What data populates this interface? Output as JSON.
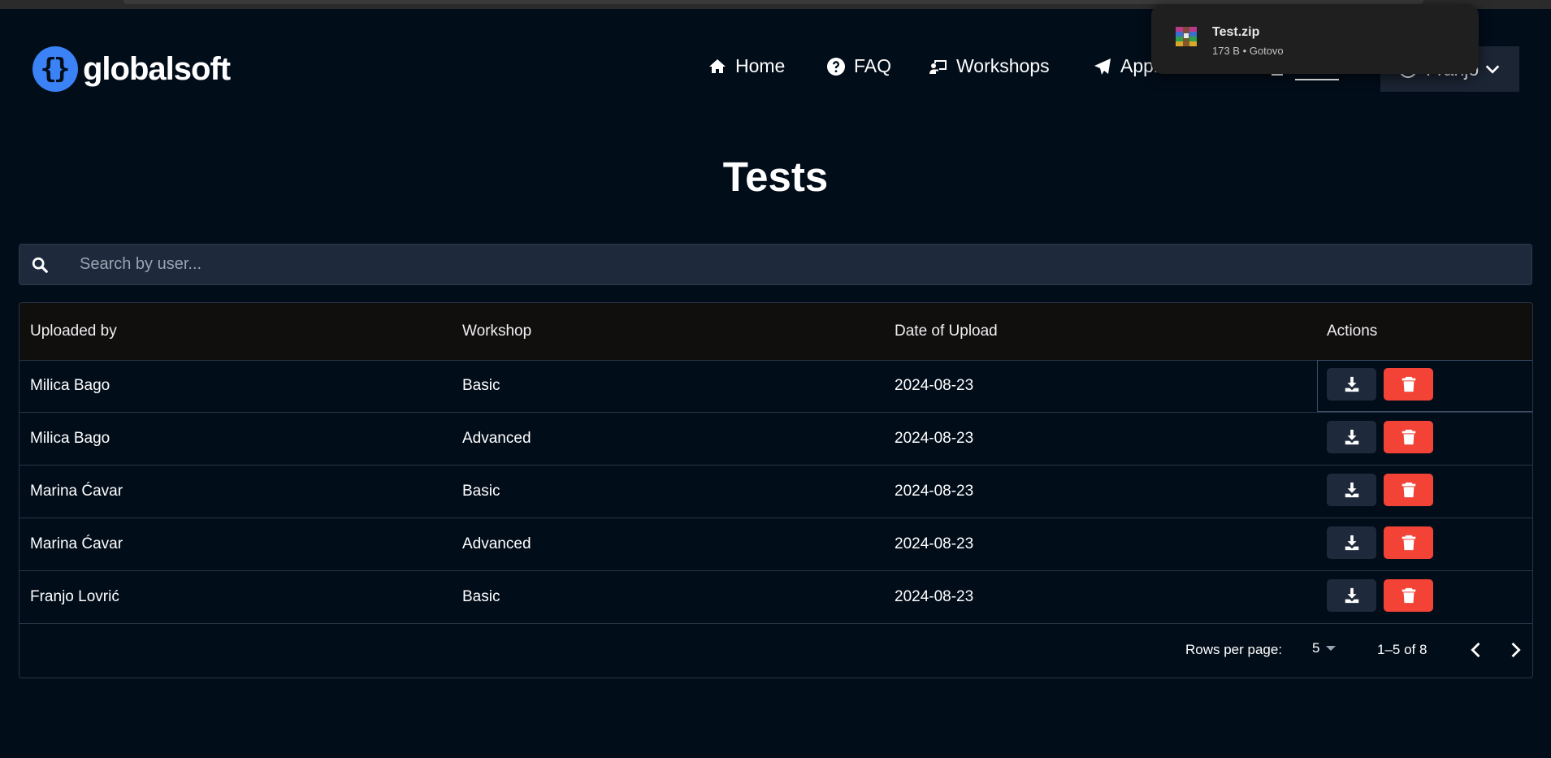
{
  "brand": {
    "name": "globalsoft",
    "logo_glyph": "{}"
  },
  "nav": {
    "items": [
      {
        "label": "Home",
        "icon": "home-icon"
      },
      {
        "label": "FAQ",
        "icon": "question-circle-icon"
      },
      {
        "label": "Workshops",
        "icon": "chalkboard-teacher-icon"
      },
      {
        "label": "Applications",
        "icon": "paper-plane-icon"
      },
      {
        "label": "Tests",
        "icon": "document-icon",
        "active": true
      }
    ],
    "user": {
      "name": "Franjo",
      "icon": "user-circle-icon"
    }
  },
  "download_popup": {
    "filename": "Test.zip",
    "meta": "173 B • Gotovo",
    "icon": "archive-icon"
  },
  "page": {
    "title": "Tests"
  },
  "search": {
    "placeholder": "Search by user...",
    "value": ""
  },
  "table": {
    "headers": [
      "Uploaded by",
      "Workshop",
      "Date of Upload",
      "Actions"
    ],
    "rows": [
      {
        "user": "Milica Bago",
        "workshop": "Basic",
        "date": "2024-08-23"
      },
      {
        "user": "Milica Bago",
        "workshop": "Advanced",
        "date": "2024-08-23"
      },
      {
        "user": "Marina Ćavar",
        "workshop": "Basic",
        "date": "2024-08-23"
      },
      {
        "user": "Marina Ćavar",
        "workshop": "Advanced",
        "date": "2024-08-23"
      },
      {
        "user": "Franjo Lovrić",
        "workshop": "Basic",
        "date": "2024-08-23"
      }
    ]
  },
  "pagination": {
    "rows_per_page_label": "Rows per page:",
    "rows_per_page": "5",
    "range": "1–5 of 8"
  },
  "colors": {
    "background": "#020d1a",
    "accent": "#3b82f6",
    "danger": "#f24336",
    "surface": "#1e2a3b"
  }
}
